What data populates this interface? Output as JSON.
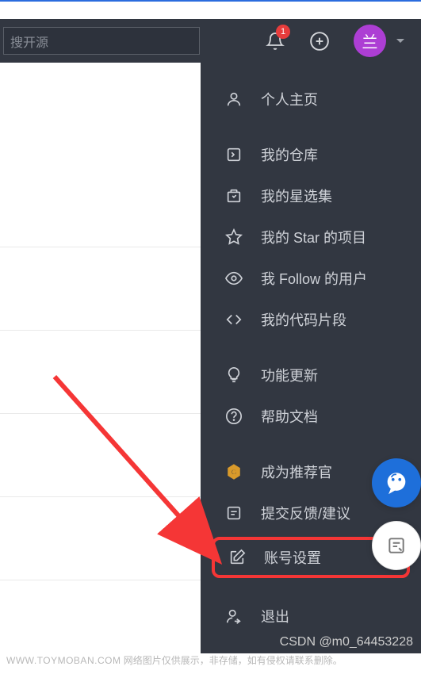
{
  "header": {
    "search_text": "搜开源",
    "notification_count": "1",
    "avatar_char": "兰"
  },
  "menu": {
    "items": [
      {
        "icon": "person",
        "label": "个人主页"
      },
      {
        "icon": "repo",
        "label": "我的仓库"
      },
      {
        "icon": "collection",
        "label": "我的星选集"
      },
      {
        "icon": "star",
        "label": "我的 Star 的项目"
      },
      {
        "icon": "eye",
        "label": "我 Follow 的用户"
      },
      {
        "icon": "code",
        "label": "我的代码片段"
      },
      {
        "icon": "bulb",
        "label": "功能更新"
      },
      {
        "icon": "help",
        "label": "帮助文档"
      },
      {
        "icon": "badge",
        "label": "成为推荐官"
      },
      {
        "icon": "feedback",
        "label": "提交反馈/建议"
      },
      {
        "icon": "settings",
        "label": "账号设置"
      },
      {
        "icon": "logout",
        "label": "退出"
      }
    ]
  },
  "watermark": {
    "right": "CSDN @m0_64453228",
    "left_host": "WWW.TOYMOBAN.COM",
    "left_text": " 网络图片仅供展示，非存储，如有侵权请联系删除。"
  }
}
